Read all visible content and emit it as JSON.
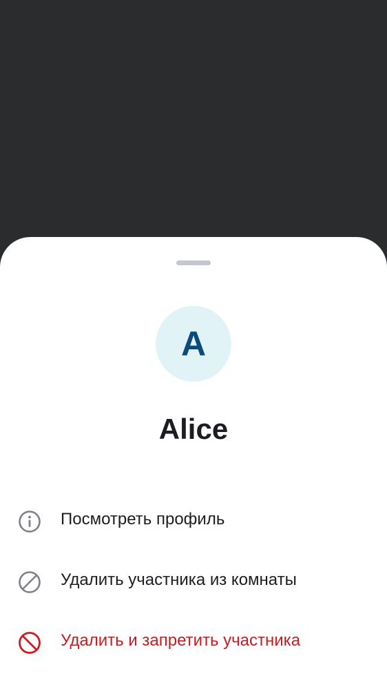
{
  "avatar": {
    "initial": "A"
  },
  "user": {
    "name": "Alice"
  },
  "menu": {
    "items": [
      {
        "label": "Посмотреть профиль",
        "icon": "info-icon"
      },
      {
        "label": "Удалить участника из комнаты",
        "icon": "block-icon"
      },
      {
        "label": "Удалить и запретить участника",
        "icon": "ban-icon"
      }
    ]
  },
  "colors": {
    "scrim": "#2b2c2e",
    "sheet": "#ffffff",
    "avatar_bg": "#e2f3f8",
    "avatar_letter": "#0b4a7a",
    "text_primary": "#1b1d22",
    "danger": "#d0181f",
    "icon_gray": "#7d808a"
  }
}
